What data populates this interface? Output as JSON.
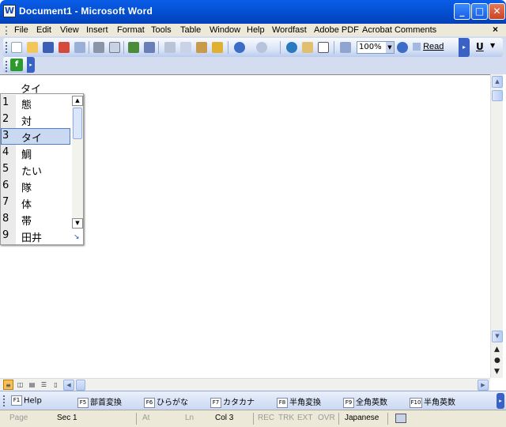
{
  "window": {
    "title": "Document1 - Microsoft Word",
    "app_icon": "W",
    "minimize_glyph": "_",
    "maximize_glyph": "□",
    "close_glyph": "✕"
  },
  "menu": {
    "items": [
      "File",
      "Edit",
      "View",
      "Insert",
      "Format",
      "Tools",
      "Table",
      "Window",
      "Help",
      "Wordfast",
      "Adobe PDF",
      "Acrobat Comments"
    ],
    "doc_close": "×"
  },
  "toolbar": {
    "zoom": "100%",
    "read_label": "Read",
    "underline_label": "U",
    "wordfast_icon": "f",
    "icons": [
      "new-icon",
      "open-icon",
      "save-icon",
      "permission-icon",
      "email-icon",
      "print-icon",
      "print-preview-icon",
      "spelling-icon",
      "research-icon",
      "cut-icon",
      "copy-icon",
      "paste-icon",
      "format-painter-icon",
      "undo-icon",
      "redo-icon",
      "hyperlink-icon",
      "tables-icon",
      "insert-table-icon",
      "drawing-icon",
      "help-icon",
      "read-icon"
    ]
  },
  "document": {
    "composition_text": "タイ"
  },
  "ime": {
    "selected_index": 3,
    "candidates": [
      {
        "num": "1",
        "text": "態"
      },
      {
        "num": "2",
        "text": "対"
      },
      {
        "num": "3",
        "text": "タイ"
      },
      {
        "num": "4",
        "text": "鯛"
      },
      {
        "num": "5",
        "text": "たい"
      },
      {
        "num": "6",
        "text": "隊"
      },
      {
        "num": "7",
        "text": "体"
      },
      {
        "num": "8",
        "text": "帯"
      },
      {
        "num": "9",
        "text": "田井"
      }
    ]
  },
  "fkeys": [
    {
      "key": "F1",
      "label": "Help"
    },
    {
      "key": "F5",
      "label": "部首変換"
    },
    {
      "key": "F6",
      "label": "ひらがな"
    },
    {
      "key": "F7",
      "label": "カタカナ"
    },
    {
      "key": "F8",
      "label": "半角変換"
    },
    {
      "key": "F9",
      "label": "全角英数"
    },
    {
      "key": "F10",
      "label": "半角英数"
    }
  ],
  "status": {
    "page": "Page",
    "sec": "Sec  1",
    "at": "At",
    "ln": "Ln",
    "col": "Col  3",
    "rec": "REC",
    "trk": "TRK",
    "ext": "EXT",
    "ovr": "OVR",
    "language": "Japanese"
  },
  "colors": {
    "titlebar": "#0553d6",
    "selection": "#c9d9f2",
    "chrome": "#ece9d8"
  }
}
